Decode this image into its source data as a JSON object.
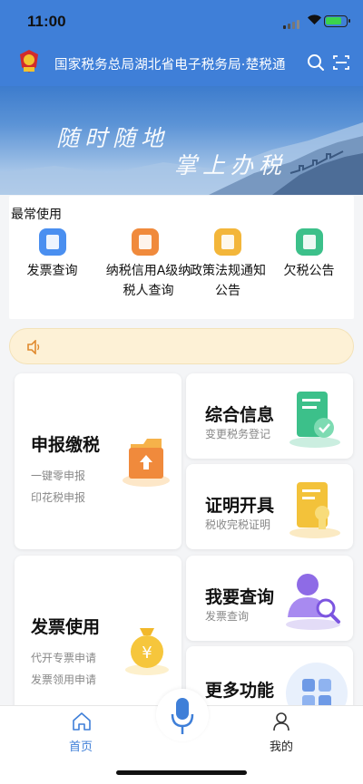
{
  "status_bar": {
    "time": "11:00"
  },
  "header": {
    "title": "国家税务总局湖北省电子税务局·楚税通"
  },
  "banner": {
    "line1": "随时随地",
    "line2": "掌上办税"
  },
  "frequent": {
    "label": "最常使用",
    "items": [
      {
        "label": "发票查询",
        "icon": "invoice-search-icon",
        "color": "#4a8ff0"
      },
      {
        "label": "纳税信用A级纳税人查询",
        "icon": "credit-rating-icon",
        "color": "#f08a3c"
      },
      {
        "label": "政策法规通知公告",
        "icon": "announcement-icon",
        "color": "#f3b63a"
      },
      {
        "label": "欠税公告",
        "icon": "tax-arrears-icon",
        "color": "#3cc08a"
      }
    ]
  },
  "notice": {
    "icon": "speaker-icon"
  },
  "tiles": {
    "declare": {
      "title": "申报缴税",
      "sub1": "一键零申报",
      "sub2": "印花税申报"
    },
    "info": {
      "title": "综合信息",
      "sub": "变更税务登记"
    },
    "cert": {
      "title": "证明开具",
      "sub": "税收完税证明"
    },
    "invoice": {
      "title": "发票使用",
      "sub1": "代开专票申请",
      "sub2": "发票领用申请"
    },
    "query": {
      "title": "我要查询",
      "sub": "发票查询"
    },
    "more": {
      "title": "更多功能"
    }
  },
  "bottom_nav": {
    "home": "首页",
    "mine": "我的",
    "active_color": "#3f7fd8"
  }
}
